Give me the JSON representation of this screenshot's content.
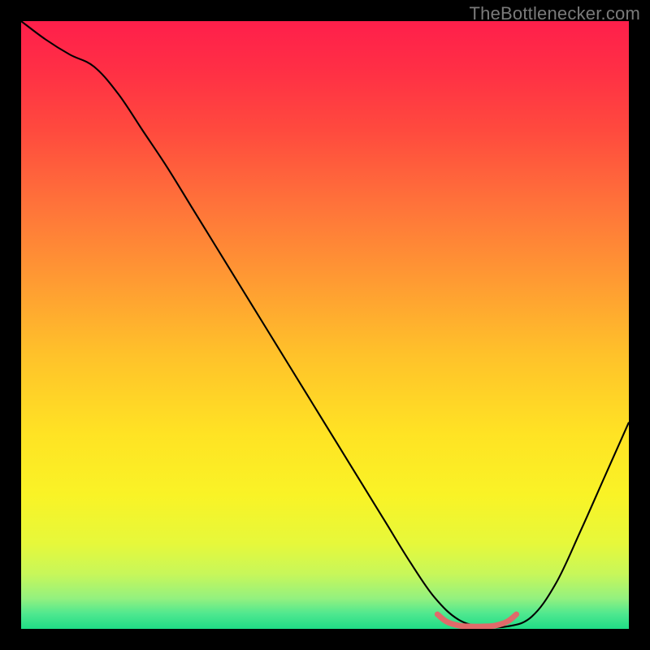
{
  "attribution": "TheBottlenecker.com",
  "chart_data": {
    "type": "line",
    "title": "",
    "xlabel": "",
    "ylabel": "",
    "xlim": [
      0,
      100
    ],
    "ylim": [
      0,
      100
    ],
    "grid": false,
    "series": [
      {
        "name": "curve",
        "x": [
          0,
          4,
          8,
          12,
          16,
          20,
          24,
          28,
          32,
          36,
          40,
          44,
          48,
          52,
          56,
          60,
          64,
          68,
          72,
          76,
          80,
          84,
          88,
          92,
          96,
          100
        ],
        "values": [
          100,
          97,
          94.5,
          92.5,
          88,
          82,
          76,
          69.5,
          63,
          56.5,
          50,
          43.5,
          37,
          30.5,
          24,
          17.5,
          11,
          5.2,
          1.5,
          0.4,
          0.4,
          2,
          7.5,
          16,
          25,
          34
        ],
        "color": "#000000",
        "width": 2.1
      },
      {
        "name": "optimal-range",
        "x": [
          68.5,
          70,
          72,
          74,
          76,
          78,
          80,
          81.5
        ],
        "values": [
          2.4,
          1.2,
          0.55,
          0.4,
          0.4,
          0.55,
          1.2,
          2.4
        ],
        "color": "#e06a6a",
        "width": 7
      }
    ],
    "background_gradient": {
      "stops": [
        {
          "offset": 0.0,
          "color": "#ff1f4b"
        },
        {
          "offset": 0.08,
          "color": "#ff2f45"
        },
        {
          "offset": 0.18,
          "color": "#ff4a3e"
        },
        {
          "offset": 0.3,
          "color": "#ff723a"
        },
        {
          "offset": 0.42,
          "color": "#ff9833"
        },
        {
          "offset": 0.55,
          "color": "#ffc22a"
        },
        {
          "offset": 0.68,
          "color": "#ffe324"
        },
        {
          "offset": 0.78,
          "color": "#f9f326"
        },
        {
          "offset": 0.86,
          "color": "#e6f83b"
        },
        {
          "offset": 0.91,
          "color": "#c7f75a"
        },
        {
          "offset": 0.95,
          "color": "#93f17f"
        },
        {
          "offset": 0.975,
          "color": "#4fe88f"
        },
        {
          "offset": 1.0,
          "color": "#1fdc86"
        }
      ]
    }
  }
}
